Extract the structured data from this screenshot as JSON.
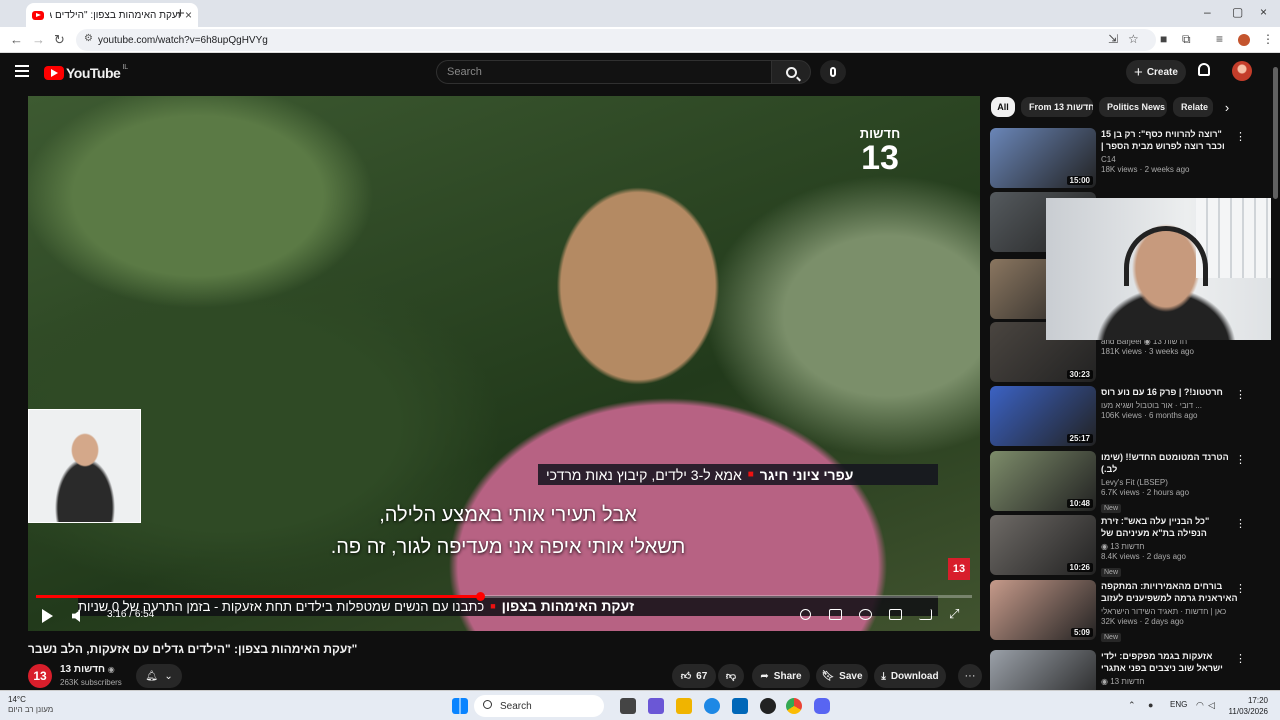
{
  "browser": {
    "tab_title": "זעקת האימהות בצפון: \"הילדים ג",
    "tab_close": "×",
    "new_tab": "+",
    "url": "youtube.com/watch?v=6h8upQgHVYg",
    "window_controls": [
      "–",
      "▢",
      "×"
    ]
  },
  "header": {
    "logo_text": "YouTube",
    "country_code": "IL",
    "search_placeholder": "Search",
    "create_label": "Create"
  },
  "player": {
    "channel_logo_top": "חדשות",
    "channel_logo_num": "13",
    "name_strap_name": "עפרי ציוני חיגר",
    "name_strap_desc": "אמא ל-3 ילדים, קיבוץ נאות מרדכי",
    "subtitle_line1": "אבל תעירי אותי באמצע הלילה,",
    "subtitle_line2": "תשאלי אותי איפה אני מעדיפה לגור, זה פה.",
    "corner_logo": "13",
    "ticker_title": "זעקת האימהות בצפון",
    "ticker_text": "כתבנו עם הנשים שמטפלות בילדים תחת אזעקות - בזמן התרעה של 0 שניות",
    "time_current": "3:16",
    "time_total": "6:54",
    "progress_fraction": 0.474
  },
  "video": {
    "title": "\"זעקת האימהות בצפון: \"הילדים גדלים עם אזעקות, הלב נשבר",
    "channel_avatar": "13",
    "channel_name": "13 חדשות",
    "verified": "◉",
    "subscribers": "263K subscribers",
    "likes": "67",
    "share_label": "Share",
    "save_label": "Save",
    "download_label": "Download",
    "more": "···"
  },
  "chips": [
    "All",
    "From 13 חדשות",
    "Politics News",
    "Relate"
  ],
  "recommendations": [
    {
      "title": "\"רוצה להרוויח כסף\": רק בן 15 וכבר רוצה לפרוש מבית הספר | פתחי את",
      "channel": "C14",
      "meta": "18K views · 2 weeks ago",
      "duration": "15:00",
      "new": "",
      "thumb": "#6a86b8"
    },
    {
      "title": "",
      "channel": "",
      "meta": "",
      "duration": "",
      "new": "",
      "thumb": "#555a5e"
    },
    {
      "title": "",
      "channel": "",
      "meta": "",
      "duration": "",
      "new": "",
      "thumb": "#8a7660"
    },
    {
      "title": "כוכב הרשת עמית ברג׳י",
      "channel": "and Barjeel ◉ חדשות 13",
      "meta": "181K views · 3 weeks ago",
      "duration": "30:23",
      "new": "",
      "thumb": "#4a4540"
    },
    {
      "title": "חרטטונ!? | פרק 16 עם נוע רוס",
      "channel": "דובי · אור בוטבול ושגיא מעו ...",
      "meta": "106K views · 6 months ago",
      "duration": "25:17",
      "new": "",
      "thumb": "#3b62c4"
    },
    {
      "title": "הטרנד המטומטם החדש!! (שימו לב.)",
      "channel": "Levy's Fit (LBSEP)",
      "meta": "6.7K views · 2 hours ago",
      "duration": "10:48",
      "new": "New",
      "thumb": "#7d8c6a"
    },
    {
      "title": "\"כל הבניין עלה באש\": זירת הנפילה בת\"א מעיניהם של השוטרים",
      "channel": "◉ חדשות 13",
      "meta": "8.4K views · 2 days ago",
      "duration": "10:26",
      "new": "New",
      "thumb": "#6e6a66"
    },
    {
      "title": "בורחים מהאמירויות: המתקפה האיראנית גרמה למשפיענים לעזוב ...",
      "channel": "כאן | חדשות · תאגיד השידור הישראלי",
      "meta": "32K views · 2 days ago",
      "duration": "5:09",
      "new": "New",
      "thumb": "#c69a8a"
    },
    {
      "title": "אזעקות בגמר מפקפים: ילדי ישראל שוב ניצבים בפני אתגרי המלחמה",
      "channel": "◉ חדשות 13",
      "meta": "",
      "duration": "",
      "new": "",
      "thumb": "#9aa0a8"
    }
  ],
  "taskbar": {
    "temp": "14°C",
    "condition": "מעונן רב היום",
    "search_label": "Search",
    "lang": "ENG",
    "time": "17:20",
    "date": "11/03/2026"
  }
}
